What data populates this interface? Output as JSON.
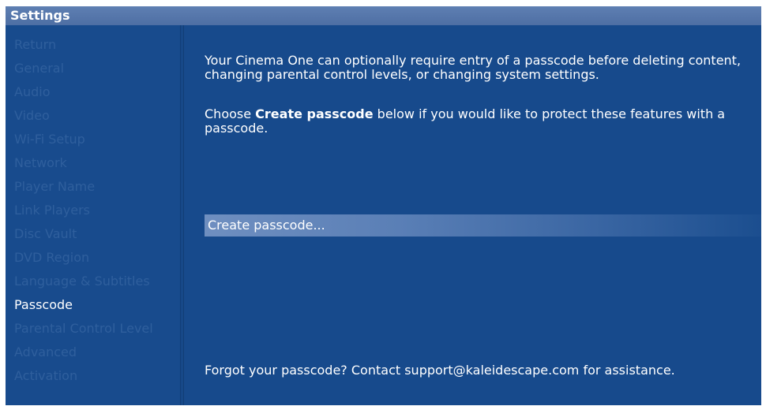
{
  "window": {
    "title": "Settings"
  },
  "sidebar": {
    "items": [
      {
        "label": "Return"
      },
      {
        "label": "General"
      },
      {
        "label": "Audio"
      },
      {
        "label": "Video"
      },
      {
        "label": "Wi-Fi Setup"
      },
      {
        "label": "Network"
      },
      {
        "label": "Player Name"
      },
      {
        "label": "Link Players"
      },
      {
        "label": "Disc Vault"
      },
      {
        "label": "DVD Region"
      },
      {
        "label": "Language & Subtitles"
      },
      {
        "label": "Passcode"
      },
      {
        "label": "Parental Control Level"
      },
      {
        "label": "Advanced"
      },
      {
        "label": "Activation"
      }
    ],
    "selected": "Passcode"
  },
  "main": {
    "intro": "Your Cinema One can optionally require entry of a passcode before deleting content, changing parental control levels, or changing system settings.",
    "choose_prefix": "Choose ",
    "choose_bold": "Create passcode",
    "choose_suffix": " below if you would like to protect these features with a passcode.",
    "action_label": "Create passcode...",
    "footer": "Forgot your passcode? Contact support@kaleidescape.com for assistance."
  },
  "colors": {
    "background": "#174a8c",
    "titlebar": "#5e7fb2",
    "inactive_item": "#2f5f9d",
    "active_item": "#ffffff"
  }
}
